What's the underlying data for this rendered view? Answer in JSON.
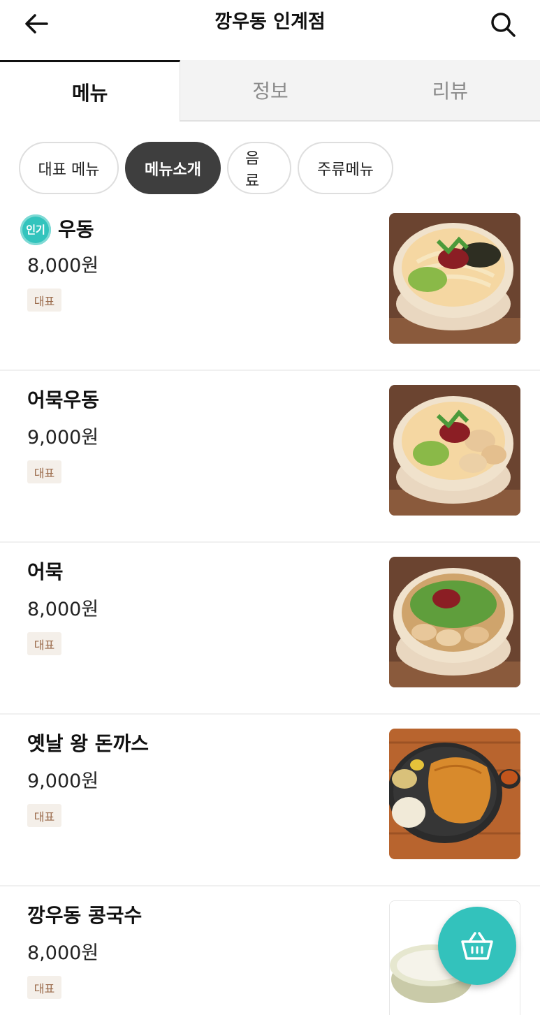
{
  "header": {
    "title": "깡우동 인계점",
    "back_icon": "arrow-left-icon",
    "search_icon": "search-icon"
  },
  "tabs": [
    {
      "label": "메뉴",
      "active": true
    },
    {
      "label": "정보",
      "active": false
    },
    {
      "label": "리뷰",
      "active": false
    }
  ],
  "chips": [
    {
      "label": "대표 메뉴",
      "selected": false
    },
    {
      "label": "메뉴소개",
      "selected": true
    },
    {
      "label": "음료",
      "selected": false
    },
    {
      "label": "주류메뉴",
      "selected": false
    }
  ],
  "popular_badge": "인기",
  "items": [
    {
      "name": "우동",
      "price": "8,000원",
      "tag": "대표",
      "popular": true,
      "image": "udon-bowl"
    },
    {
      "name": "어묵우동",
      "price": "9,000원",
      "tag": "대표",
      "popular": false,
      "image": "fishcake-udon-bowl"
    },
    {
      "name": "어묵",
      "price": "8,000원",
      "tag": "대표",
      "popular": false,
      "image": "fishcake-bowl"
    },
    {
      "name": "옛날 왕 돈까스",
      "price": "9,000원",
      "tag": "대표",
      "popular": false,
      "image": "pork-cutlet-plate"
    },
    {
      "name": "깡우동 콩국수",
      "price": "8,000원",
      "tag": "대표",
      "popular": false,
      "image": "soy-noodle-bowl"
    }
  ],
  "cart_icon": "basket-icon",
  "colors": {
    "accent": "#33c2bc",
    "chip_selected": "#3e3e3e",
    "tag_bg": "#f4efe9",
    "tag_text": "#9a6a4a"
  }
}
